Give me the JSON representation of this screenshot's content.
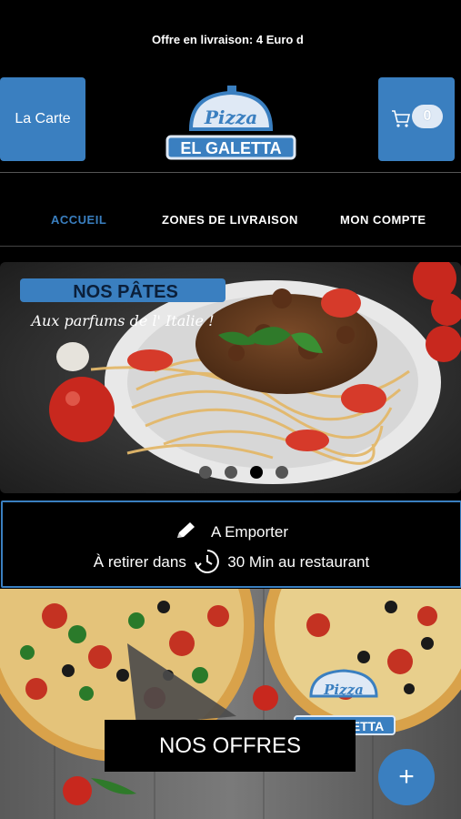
{
  "header": {
    "ticker": "Offre en livraison: 4 Euro d",
    "menu_button": "La Carte",
    "cart_count": "0",
    "logo_script": "Pizza",
    "logo_name": "EL GALETTA"
  },
  "nav": {
    "items": [
      "ACCUEIL",
      "ZONES DE LIVRAISON",
      "MON COMPTE"
    ],
    "active": "ACCUEIL"
  },
  "banner": {
    "title": "NOS PÂTES",
    "subtitle": "Aux parfums de l' Italie !",
    "slides": 4,
    "active_slide": 3
  },
  "takeaway": {
    "mode": "A Emporter",
    "pickup_prefix": "À retirer dans",
    "pickup_time": "30 Min au restaurant"
  },
  "offers": {
    "label": "NOS OFFRES",
    "logo_script": "Pizza",
    "logo_name": "EL GALETTA"
  },
  "fab": {
    "label": "+"
  },
  "colors": {
    "accent": "#3a7fc0",
    "background": "#000000"
  }
}
